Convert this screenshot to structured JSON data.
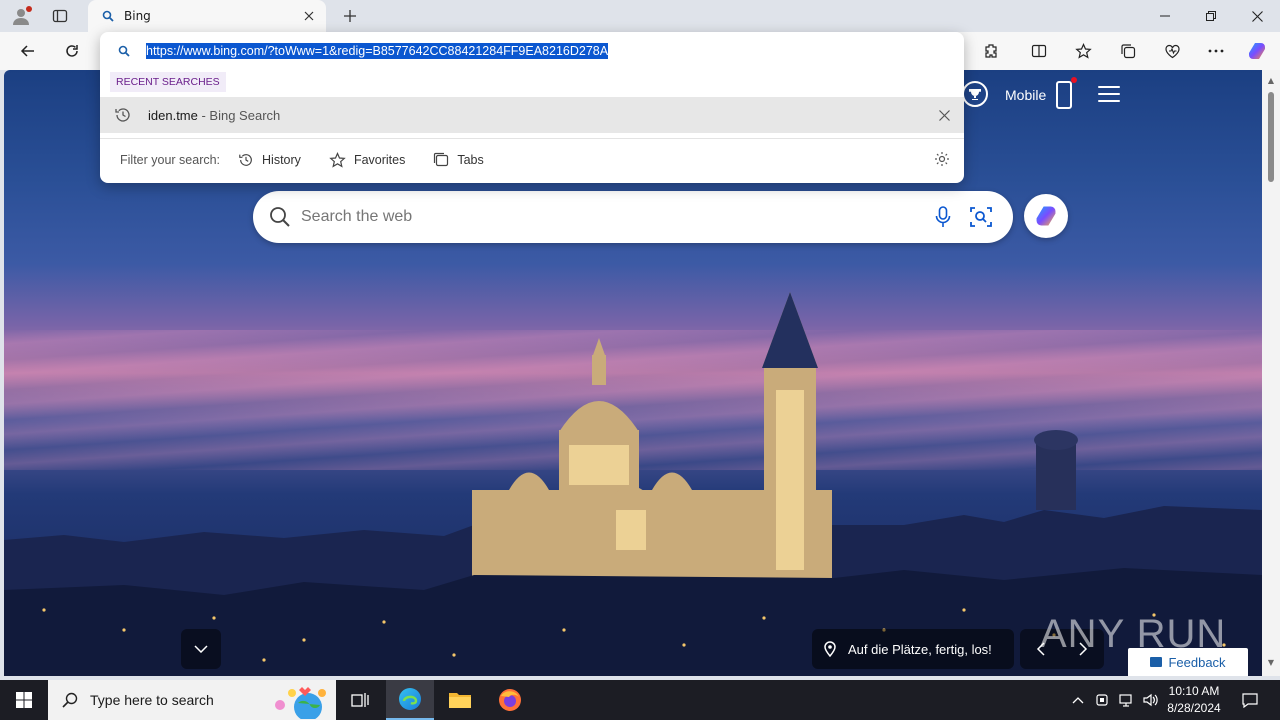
{
  "browser": {
    "tab": {
      "title": "Bing"
    },
    "address": {
      "url": "https://www.bing.com/?toWww=1&redig=B8577642CC88421284FF9EA8216D278A"
    }
  },
  "omnibox": {
    "section_label": "RECENT SEARCHES",
    "recent": [
      {
        "query": "iden.tme",
        "suffix": " - Bing Search"
      }
    ],
    "filter_label": "Filter your search:",
    "filters": [
      "History",
      "Favorites",
      "Tabs"
    ]
  },
  "bing": {
    "mobile_label": "Mobile",
    "search_placeholder": "Search the web",
    "caption": "Auf die Plätze, fertig, los!",
    "feedback": "Feedback",
    "watermark": "ANY RUN"
  },
  "taskbar": {
    "search_placeholder": "Type here to search",
    "time": "10:10 AM",
    "date": "8/28/2024"
  },
  "colors": {
    "accent": "#0b57d0",
    "notification_dot": "#e81123",
    "section_text": "#6b1f8c",
    "feedback_text": "#1b5fa8"
  }
}
